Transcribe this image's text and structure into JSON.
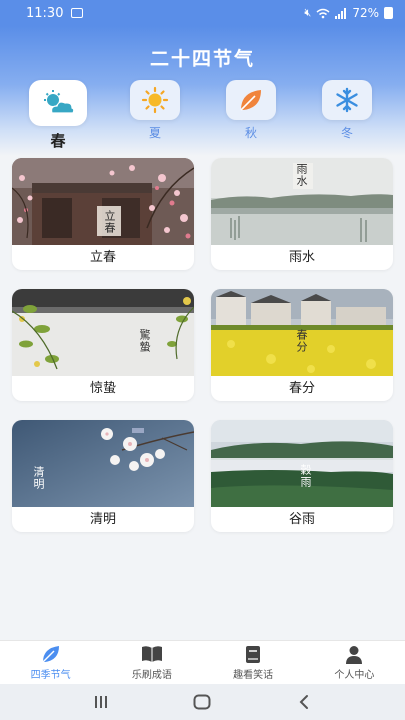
{
  "status_bar": {
    "time": "11:30",
    "battery": "72%"
  },
  "app": {
    "title": "二十四节气"
  },
  "seasons": [
    {
      "label": "春",
      "icon": "sun-cloud-icon"
    },
    {
      "label": "夏",
      "icon": "sun-icon"
    },
    {
      "label": "秋",
      "icon": "leaf-icon"
    },
    {
      "label": "冬",
      "icon": "snowflake-icon"
    }
  ],
  "terms": [
    {
      "label": "立春",
      "seal": "立春"
    },
    {
      "label": "雨水",
      "seal": "雨水"
    },
    {
      "label": "惊蛰",
      "seal": "驚蟄"
    },
    {
      "label": "春分",
      "seal": "春分"
    },
    {
      "label": "清明",
      "seal": "清明"
    },
    {
      "label": "谷雨",
      "seal": "穀雨"
    }
  ],
  "bottom_nav": [
    {
      "label": "四季节气",
      "icon": "leaf-icon"
    },
    {
      "label": "乐刷成语",
      "icon": "book-icon"
    },
    {
      "label": "趣看笑话",
      "icon": "notebook-icon"
    },
    {
      "label": "个人中心",
      "icon": "person-icon"
    }
  ],
  "colors": {
    "accent": "#4b8ef0",
    "header": "#5a8ee8",
    "season_label": "#5b8de4"
  }
}
